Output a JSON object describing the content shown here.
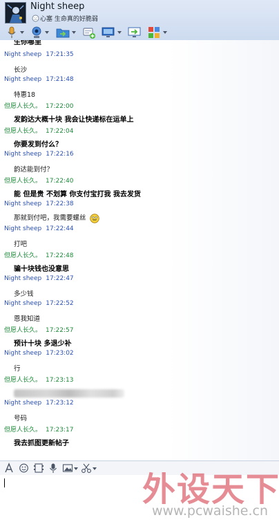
{
  "header": {
    "contact_name": "Night sheep",
    "signature": "心塞 生命真的好脆弱"
  },
  "toolbar": {
    "icons": [
      "microphone-icon",
      "video-call-icon",
      "file-transfer-icon",
      "add-friend-icon",
      "remote-desktop-icon",
      "share-screen-icon",
      "apps-icon"
    ]
  },
  "chat": {
    "top_partial": "生你哪里",
    "messages": [
      {
        "sender": "Night sheep",
        "time": "17:21:35",
        "text": "长沙",
        "self": true
      },
      {
        "sender": "Night sheep",
        "time": "17:21:48",
        "text": "特惠18",
        "self": true
      },
      {
        "sender": "但愿人长久。",
        "time": "17:22:00",
        "text": "发韵达大概十块 我会让快递标在运单上",
        "self": false
      },
      {
        "sender": "但愿人长久。",
        "time": "17:22:04",
        "text": "你要发到付么？",
        "self": false
      },
      {
        "sender": "Night sheep",
        "time": "17:22:16",
        "text": "韵达能到付？",
        "self": true
      },
      {
        "sender": "但愿人长久。",
        "time": "17:22:40",
        "text": "能 但是贵 不划算 你支付宝打我 我去发货",
        "self": false
      },
      {
        "sender": "Night sheep",
        "time": "17:22:38",
        "text": "那就到付吧，我需要螺丝",
        "self": true
      },
      {
        "sender": "Night sheep",
        "time": "17:22:44",
        "text": "打吧",
        "self": true
      },
      {
        "sender": "但愿人长久。",
        "time": "17:22:48",
        "text": "骗十块钱也没意思",
        "self": false
      },
      {
        "sender": "Night sheep",
        "time": "17:22:47",
        "text": "多少钱",
        "self": true
      },
      {
        "sender": "Night sheep",
        "time": "17:22:52",
        "text": "恩我知道",
        "self": true
      },
      {
        "sender": "但愿人长久。",
        "time": "17:22:57",
        "text": "预计十块 多退少补",
        "self": false
      },
      {
        "sender": "Night sheep",
        "time": "17:23:02",
        "text": "行",
        "self": true
      },
      {
        "sender": "但愿人长久。",
        "time": "17:23:13",
        "text": "",
        "self": false
      },
      {
        "sender": "Night sheep",
        "time": "17:23:12",
        "text": "号码",
        "self": true
      },
      {
        "sender": "但愿人长久。",
        "time": "17:23:17",
        "text": "我去抓图更新帖子",
        "self": false
      }
    ]
  },
  "input_toolbar": {
    "icons": [
      "font-icon",
      "emoji-icon",
      "video-clip-icon",
      "voice-icon",
      "image-icon",
      "screenshot-icon"
    ]
  },
  "watermark": {
    "title": "外设天下",
    "url": "www.pcwaishe.cn"
  }
}
